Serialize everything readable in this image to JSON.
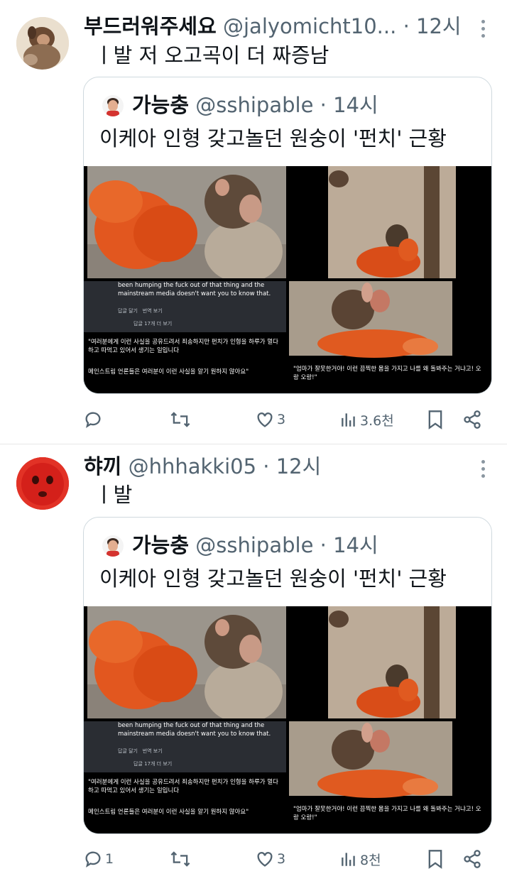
{
  "posts": [
    {
      "name": "부드러워주세요",
      "handle": "@jalyomicht10...",
      "time": "· 12시",
      "text": "ㅣ발 저 오고곡이 더 짜증남",
      "quote": {
        "name": "가능충",
        "handle": "@sshipable",
        "time": "· 14시",
        "text": "이케아 인형 갖고놀던 원숭이 '펀치' 근황",
        "caption_en": "been humping the fuck out of that thing and the mainstream media doesn't want you to know that.",
        "caption_ui_reply": "답글 달기",
        "caption_ui_translate": "번역 보기",
        "caption_more_replies": "답글 17개 더 보기",
        "caption_ko1": "\"여러분에게 이런 사실을 공유드려서 죄송하지만 펀치가 인형을 하루가 멀다 하고 따먹고 있어서 생기는 일입니다",
        "caption_ko2": "메인스트림 언론들은 여러분이 이런 사실을 알기 원하지 않아요\"",
        "caption_right": "\"엄마가 잘못한거야! 이런 끔찍한 몸을 가지고 나를 왜 돌봐주는 거냐고! 오랑 오랑!\""
      },
      "actions": {
        "reply": "",
        "retweet": "",
        "like": "3",
        "views": "3.6천"
      }
    },
    {
      "name": "햐끼",
      "handle": "@hhhakki05",
      "time": "· 12시",
      "text": "ㅣ발",
      "quote": {
        "name": "가능충",
        "handle": "@sshipable",
        "time": "· 14시",
        "text": "이케아 인형 갖고놀던 원숭이 '펀치' 근황",
        "caption_en": "been humping the fuck out of that thing and the mainstream media doesn't want you to know that.",
        "caption_ui_reply": "답글 달기",
        "caption_ui_translate": "번역 보기",
        "caption_more_replies": "답글 17개 더 보기",
        "caption_ko1": "\"여러분에게 이런 사실을 공유드려서 죄송하지만 펀치가 인형을 하루가 멀다 하고 따먹고 있어서 생기는 일입니다",
        "caption_ko2": "메인스트림 언론들은 여러분이 이런 사실을 알기 원하지 않아요\"",
        "caption_right": "\"엄마가 잘못한거야! 이런 끔찍한 몸을 가지고 나를 왜 돌봐주는 거냐고! 오랑 오랑!\""
      },
      "actions": {
        "reply": "1",
        "retweet": "",
        "like": "3",
        "views": "8천"
      }
    }
  ],
  "icons": [
    "reply-icon",
    "retweet-icon",
    "like-icon",
    "views-icon",
    "bookmark-icon",
    "share-icon",
    "more-icon"
  ]
}
